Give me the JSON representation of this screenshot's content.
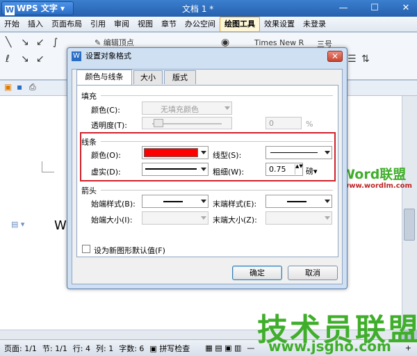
{
  "app": {
    "menu_label": "WPS 文字",
    "doc_title": "文档 1 *",
    "win_controls": [
      "—",
      "☐",
      "✕"
    ]
  },
  "menu": [
    "开始",
    "插入",
    "页面布局",
    "引用",
    "审阅",
    "视图",
    "章节",
    "办公空间",
    "绘图工具",
    "效果设置",
    "未登录"
  ],
  "ribbon": {
    "edit_vertex": "编辑顶点",
    "font_name": "Times New R",
    "font_size": "三号"
  },
  "doc": {
    "visible_text": "W"
  },
  "status": {
    "page": "页面: 1/1",
    "section": "节: 1/1",
    "row": "行: 4",
    "col": "列: 1",
    "chars": "字数: 6",
    "spell": "拼写检查"
  },
  "dialog": {
    "title": "设置对象格式",
    "tabs": [
      "颜色与线条",
      "大小",
      "版式"
    ],
    "fill": {
      "header": "填充",
      "color_label": "颜色(C):",
      "color_value": "无填充颜色",
      "transparency_label": "透明度(T):",
      "transparency_value": "0",
      "transparency_unit": "%"
    },
    "line": {
      "header": "线条",
      "color_label": "颜色(O):",
      "color_value": "#ff0000",
      "style_label": "线型(S):",
      "dash_label": "虚实(D):",
      "weight_label": "粗细(W):",
      "weight_value": "0.75",
      "weight_unit": "磅"
    },
    "arrows": {
      "header": "箭头",
      "begin_style_label": "始端样式(B):",
      "end_style_label": "末端样式(E):",
      "begin_size_label": "始端大小(I):",
      "end_size_label": "末端大小(Z):"
    },
    "default_checkbox": "设为新图形默认值(F)",
    "ok": "确定",
    "cancel": "取消"
  },
  "watermarks": {
    "brand1": "Word联盟",
    "url1": "www.wordlm.com",
    "brand2": "技术员联盟",
    "url2": "www.jsgho.com"
  },
  "colors": {
    "accent": "#2560ad",
    "highlight": "#d0202a",
    "line_color": "#ff0000",
    "watermark_green": "#3fae2a"
  }
}
